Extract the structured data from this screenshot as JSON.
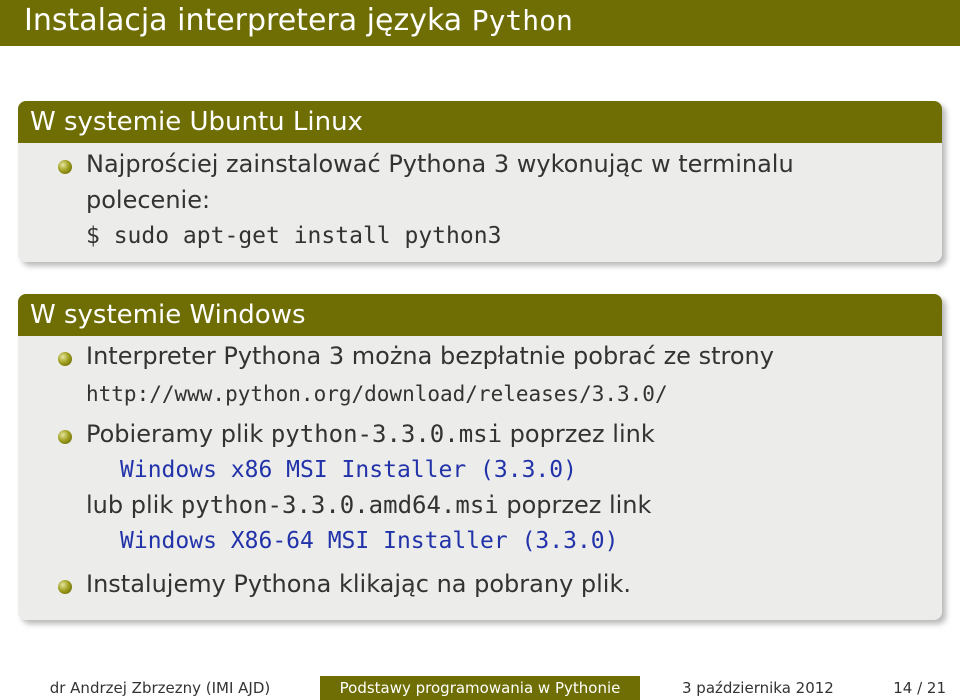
{
  "title": {
    "text": "Instalacja interpretera języka ",
    "code": "Python"
  },
  "ubuntu_block": {
    "heading": "W systemie Ubuntu Linux",
    "bullet1_line1": "Najprościej zainstalować Pythona 3 wykonując w terminalu",
    "bullet1_line2": "polecenie:",
    "command": "$ sudo apt-get install python3"
  },
  "windows_block": {
    "heading": "W systemie Windows",
    "bullet1_line1": "Interpreter Pythona 3 można bezpłatnie pobrać ze strony",
    "url": "http://www.python.org/download/releases/3.3.0/",
    "bullet2_pre": "Pobieramy plik ",
    "bullet2_file": "python-3.3.0.msi",
    "bullet2_post": " poprzez link",
    "link1": "Windows x86 MSI Installer (3.3.0)",
    "or_pre": "lub plik ",
    "or_file": "python-3.3.0.amd64.msi",
    "or_post": " poprzez link",
    "link2": "Windows X86-64 MSI Installer (3.3.0)",
    "bullet3": "Instalujemy Pythona klikając na pobrany plik."
  },
  "footer": {
    "author": "dr Andrzej Zbrzezny (IMI AJD)",
    "course": "Podstawy programowania w Pythonie",
    "date": "3 października 2012",
    "page": "14 / 21"
  }
}
